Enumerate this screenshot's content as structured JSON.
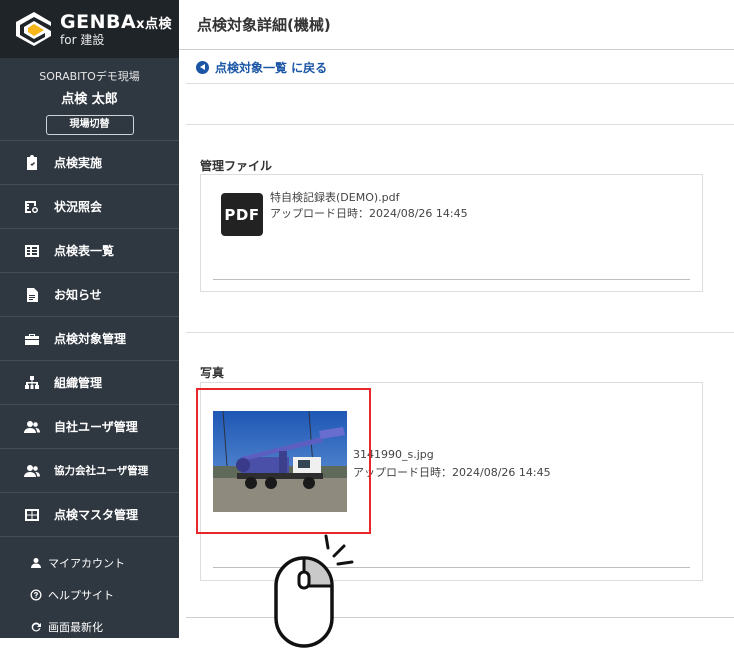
{
  "app": {
    "logo_main": "GENBA",
    "logo_suffix": "x点検",
    "logo_sub": "for 建設"
  },
  "sidebar": {
    "site_name": "SORABITOデモ現場",
    "user_name": "点検 太郎",
    "switch_label": "現場切替",
    "items": [
      {
        "label": "点検実施",
        "icon": "clipboard-check-icon"
      },
      {
        "label": "状況照会",
        "icon": "status-search-icon"
      },
      {
        "label": "点検表一覧",
        "icon": "table-list-icon"
      },
      {
        "label": "お知らせ",
        "icon": "document-icon"
      },
      {
        "label": "点検対象管理",
        "icon": "toolbox-icon"
      },
      {
        "label": "組織管理",
        "icon": "org-chart-icon"
      },
      {
        "label": "自社ユーザ管理",
        "icon": "users-icon"
      },
      {
        "label": "協力会社ユーザ管理",
        "icon": "users-icon"
      },
      {
        "label": "点検マスタ管理",
        "icon": "grid-icon"
      }
    ],
    "sub_links": [
      {
        "label": "マイアカウント",
        "icon": "person-icon"
      },
      {
        "label": "ヘルプサイト",
        "icon": "help-icon"
      },
      {
        "label": "画面最新化",
        "icon": "refresh-icon"
      }
    ]
  },
  "header": {
    "title": "点検対象詳細(機械)"
  },
  "main": {
    "back_label": "点検対象一覧 に戻る",
    "files_section": {
      "title": "管理ファイル",
      "file_name": "特自検記録表(DEMO).pdf",
      "upload_date": "アップロード日時：2024/08/26 14:45",
      "icon_label": "PDF"
    },
    "photos_section": {
      "title": "写真",
      "file_name": "3141990_s.jpg",
      "upload_date": "アップロード日時：2024/08/26 14:45"
    }
  },
  "colors": {
    "sidebar_bg": "#2f3740",
    "logo_bg": "#1f2428",
    "link_blue": "#1a55a6",
    "highlight_red": "#e8262b"
  }
}
